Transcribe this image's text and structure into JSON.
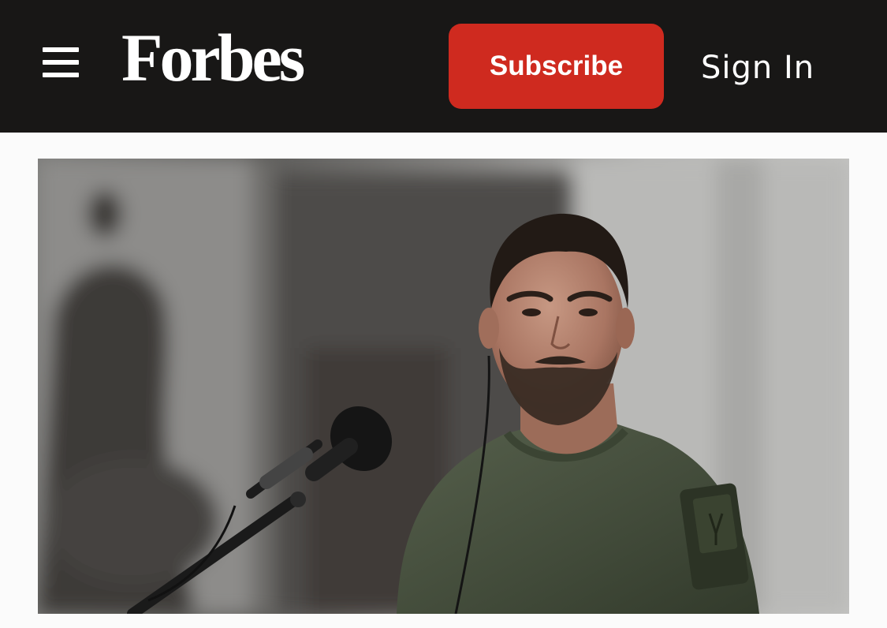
{
  "header": {
    "logo_text": "Forbes",
    "subscribe_label": "Subscribe",
    "signin_label": "Sign In"
  },
  "icons": {
    "menu": "hamburger-menu-icon"
  },
  "colors": {
    "header_bg": "#181716",
    "subscribe_bg": "#cf2a1f",
    "page_bg": "#fbfbfb"
  }
}
